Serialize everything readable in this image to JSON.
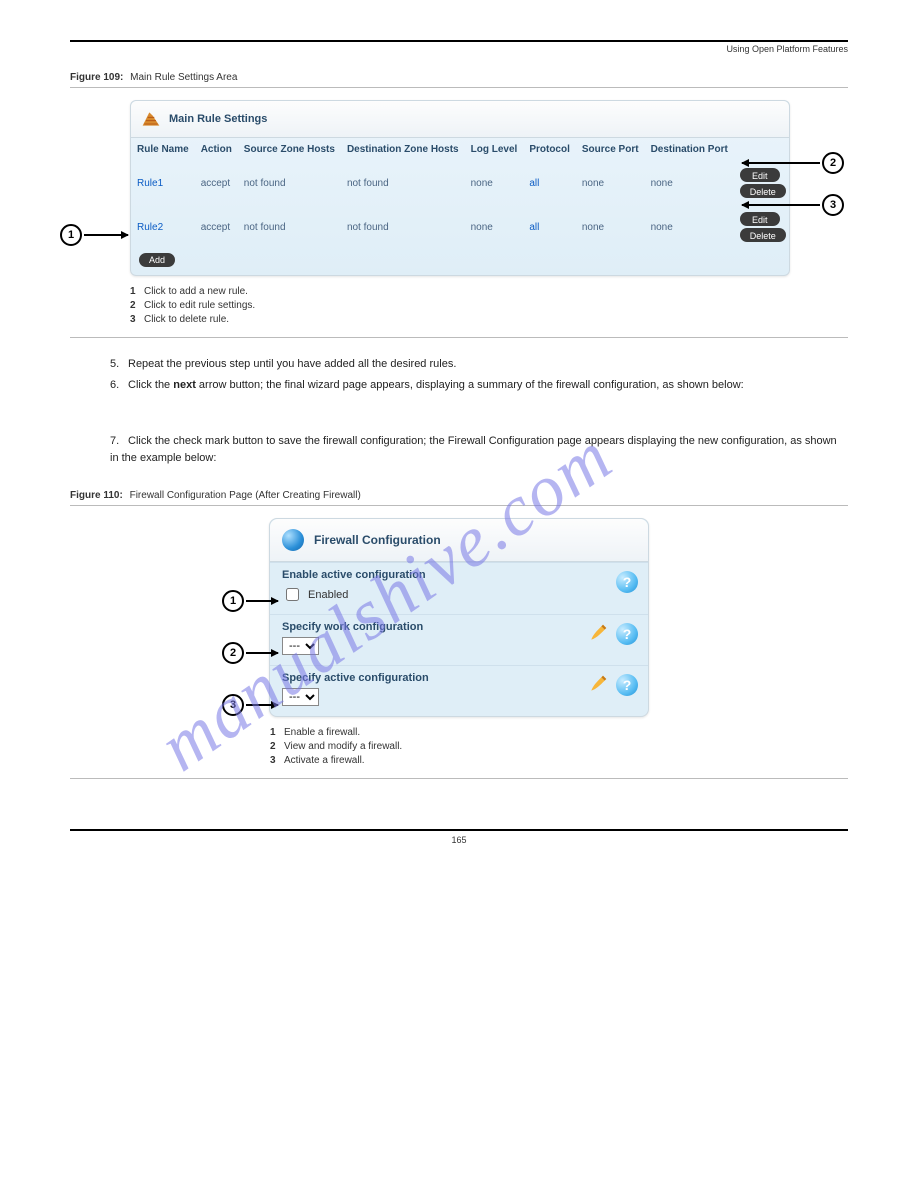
{
  "header": {
    "product": "",
    "right_text": "Using Open Platform Features"
  },
  "figure1": {
    "figure_label": "Figure 109:",
    "figure_title": "Main Rule Settings Area",
    "sheet": "",
    "panel_title": "Main Rule Settings",
    "columns": {
      "rule_name": "Rule Name",
      "action": "Action",
      "src_hosts": "Source Zone Hosts",
      "dst_hosts": "Destination Zone Hosts",
      "log_level": "Log Level",
      "protocol": "Protocol",
      "src_port": "Source Port",
      "dst_port": "Destination Port"
    },
    "rows": [
      {
        "rule_name": "Rule1",
        "action": "accept",
        "src_hosts": "not found",
        "dst_hosts": "not found",
        "log_level": "none",
        "protocol": "all",
        "src_port": "none",
        "dst_port": "none",
        "edit": "Edit",
        "delete": "Delete"
      },
      {
        "rule_name": "Rule2",
        "action": "accept",
        "src_hosts": "not found",
        "dst_hosts": "not found",
        "log_level": "none",
        "protocol": "all",
        "src_port": "none",
        "dst_port": "none",
        "edit": "Edit",
        "delete": "Delete"
      }
    ],
    "add_label": "Add",
    "callouts": {
      "c1": "1",
      "c2": "2",
      "c3": "3"
    },
    "annotations": [
      {
        "n": "1",
        "text": "Click to add a new rule."
      },
      {
        "n": "2",
        "text": "Click to edit rule settings."
      },
      {
        "n": "3",
        "text": "Click to delete rule."
      }
    ]
  },
  "steps": {
    "s5": "5.",
    "s5_text": "Repeat the previous step until you have added all the desired rules.",
    "s6": "6.",
    "s6_text_a": "Click the ",
    "s6_bold": "next",
    "s6_text_b": " arrow button; the final wizard page appears, displaying a summary of the firewall configuration, as shown below:",
    "s7": "7.",
    "s7_text": "Click the check mark button to save the firewall configuration; the Firewall Configuration page appears displaying the new configuration, as shown in the example below:"
  },
  "figure2": {
    "figure_label": "Figure 110:",
    "figure_title": "Firewall Configuration Page (After Creating Firewall)",
    "sheet": "",
    "panel_title": "Firewall Configuration",
    "sec1_label": "Enable active configuration",
    "enabled_label": "Enabled",
    "sec2_label": "Specify work configuration",
    "sec3_label": "Specify active configuration",
    "select_value": "---",
    "callouts": {
      "c1": "1",
      "c2": "2",
      "c3": "3"
    },
    "annotations": [
      {
        "n": "1",
        "text": "Enable a firewall."
      },
      {
        "n": "2",
        "text": "View and modify a firewall."
      },
      {
        "n": "3",
        "text": "Activate a firewall."
      }
    ]
  },
  "footer": {
    "version": "",
    "page": "165",
    "doc": ""
  },
  "watermark": "manualshive.com"
}
